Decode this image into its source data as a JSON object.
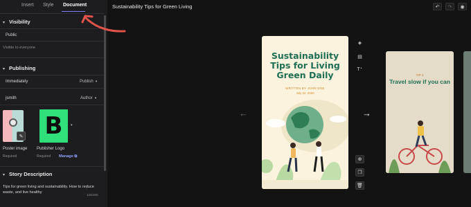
{
  "tabs": [
    {
      "label": "Insert"
    },
    {
      "label": "Style"
    },
    {
      "label": "Document"
    }
  ],
  "document_title": "Sustainability Tips for Green Living",
  "visibility": {
    "header": "Visibility",
    "value": "Public",
    "hint": "Visible to everyone"
  },
  "publishing": {
    "header": "Publishing",
    "schedule_label": "Immediately",
    "schedule_value": "Publish",
    "author_label": "jsmith",
    "author_value": "Author"
  },
  "media": {
    "poster_label": "Poster image",
    "poster_required": "Required",
    "logo_letter": "B",
    "logo_label": "Publisher Logo",
    "logo_required": "Required",
    "manage_label": "Manage"
  },
  "story_description": {
    "header": "Story Description",
    "text": "Tips for green living and sustainability. How to reduce waste, and live healthy",
    "count": "128/200"
  },
  "story_page": {
    "title": "Sustainability Tips for Living Green Daily",
    "byline": "WRITTEN BY JOHN DOE",
    "date": "July 22, 2020"
  },
  "next_page": {
    "tip_label": "TIP 1",
    "tip_title": "Travel slow if you can"
  },
  "icons": {
    "section_toggle": "chevron-down-icon",
    "undo": "undo-icon",
    "redo": "redo-icon",
    "preview": "eye-icon",
    "prev": "arrow-left-icon",
    "next": "arrow-right-icon"
  },
  "colors": {
    "accent": "#7f7fff",
    "annotation_arrow": "#e0524a",
    "page_title": "#1e6f55",
    "logo_bg": "#2fe07a"
  }
}
